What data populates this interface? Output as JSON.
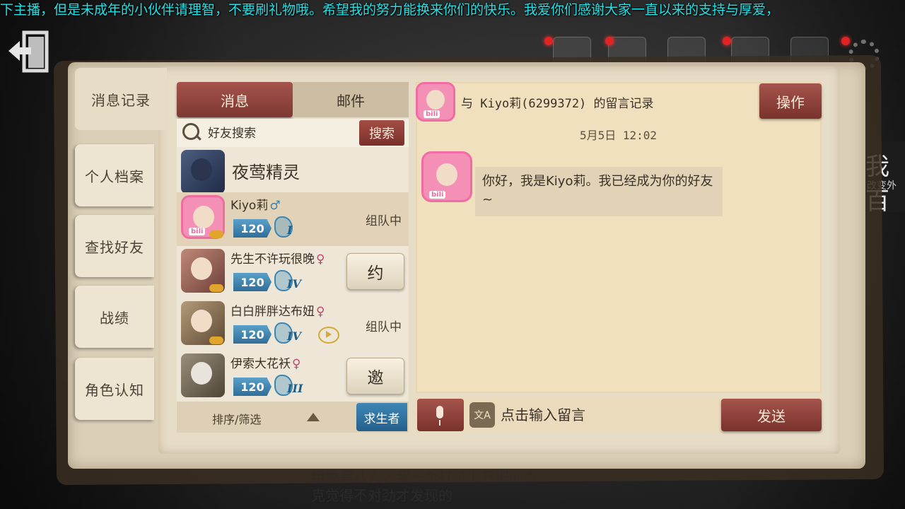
{
  "marquee": {
    "text": "下主播，但是未成年的小伙伴请理智，不要刷礼物哦。希望我的努力能换来你们的快乐。我爱你们感谢大家一直以来的支持与厚爱，"
  },
  "colors": {
    "marquee": "#24e1e6",
    "accent_red": "#8e423b",
    "level_blue": "#3a86b4",
    "paper": "#f1e0bd",
    "red_dot": "#e02424"
  },
  "side_tabs": [
    {
      "label": "消息记录",
      "active": true
    },
    {
      "label": "个人档案",
      "active": false
    },
    {
      "label": "查找好友",
      "active": false
    },
    {
      "label": "战绩",
      "active": false
    },
    {
      "label": "角色认知",
      "active": false
    }
  ],
  "tabs": {
    "messages": "消息",
    "mail": "邮件"
  },
  "search": {
    "placeholder": "好友搜索",
    "button": "搜索"
  },
  "friends": [
    {
      "name": "夜莺精灵",
      "gender": "",
      "level": "",
      "rank": "",
      "status": "",
      "action": "",
      "avatar": "dark"
    },
    {
      "name": "Kiyo莉",
      "gender": "♂",
      "level": "120",
      "rank": "I",
      "status": "组队中",
      "action": "",
      "avatar": "bili"
    },
    {
      "name": "先生不许玩很晚",
      "gender": "♀",
      "level": "120",
      "rank": "IV",
      "status": "",
      "action": "约",
      "avatar": "warm1"
    },
    {
      "name": "白白胖胖达布妞",
      "gender": "♀",
      "level": "120",
      "rank": "IV",
      "status": "组队中",
      "action": "",
      "avatar": "warm2"
    },
    {
      "name": "伊索大花袄",
      "gender": "♀",
      "level": "120",
      "rank": "III",
      "status": "",
      "action": "邀",
      "avatar": "pale"
    }
  ],
  "sort": {
    "label": "排序/筛选",
    "role": "求生者"
  },
  "chat": {
    "title": "与 Kiyo莉(6299372) 的留言记录",
    "operate_button": "操作",
    "timestamp": "5月5日 12:02",
    "message": "你好，我是Kiyo莉。我已经成为你的好友~",
    "input_placeholder": "点击输入留言",
    "send_button": "发送"
  },
  "background": {
    "right_peek_big": "我百",
    "right_peek_small": "改变外",
    "subtitle_line1": "组委黑八人，我一个打了上万把的杰",
    "subtitle_line2": "克觉得不对劲才发现的"
  },
  "icons": {
    "back": "exit-door-icon",
    "search": "magnifier-icon",
    "mic": "microphone-icon",
    "translate": "translate-icon",
    "sort": "triangle-up-icon",
    "settings": "gear-icon"
  }
}
